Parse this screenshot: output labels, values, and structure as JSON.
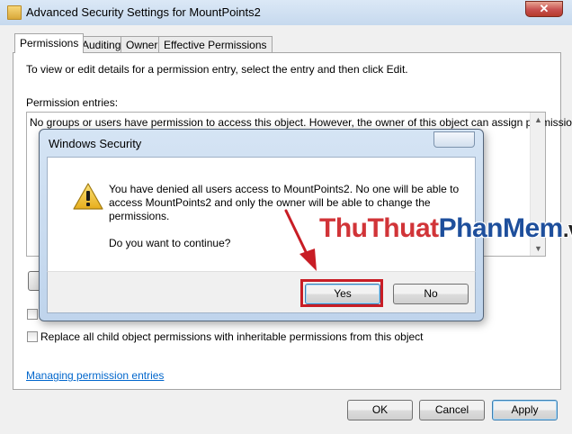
{
  "window": {
    "title": "Advanced Security Settings for MountPoints2",
    "close_glyph": "✕"
  },
  "tabs": [
    {
      "label": "Permissions",
      "active": true
    },
    {
      "label": "Auditing",
      "active": false
    },
    {
      "label": "Owner",
      "active": false
    },
    {
      "label": "Effective Permissions",
      "active": false
    }
  ],
  "permissions": {
    "instructions": "To view or edit details for a permission entry, select the entry and then click Edit.",
    "entries_label": "Permission entries:",
    "empty_message": "No groups or users have permission to access this object. However, the owner of this object can assign permissions.",
    "include_checked": false,
    "replace_label": "Replace all child object permissions with inheritable permissions from this object",
    "replace_checked": false,
    "manage_link": "Managing permission entries"
  },
  "footer": {
    "ok_label": "OK",
    "cancel_label": "Cancel",
    "apply_label": "Apply"
  },
  "dialog": {
    "title": "Windows Security",
    "message": "You have denied all users access to MountPoints2. No one will be able to access MountPoints2 and only the owner will be able to change the permissions.",
    "question": "Do you want to continue?",
    "yes_label": "Yes",
    "no_label": "No",
    "icon": "warning-icon"
  },
  "watermark": {
    "part1": "ThuThuat",
    "part2": "PhanMem",
    "part3": ".vn"
  },
  "colors": {
    "highlight": "#c81d25",
    "link": "#0066cc",
    "warning": "#f2c53d"
  }
}
